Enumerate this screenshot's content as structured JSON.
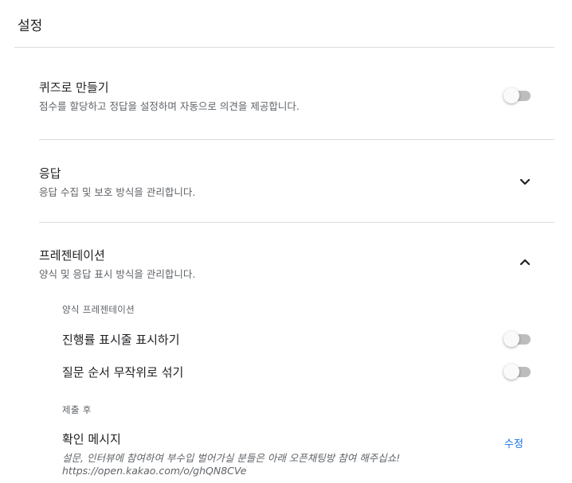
{
  "page": {
    "title": "설정"
  },
  "quiz": {
    "title": "퀴즈로 만들기",
    "description": "점수를 할당하고 정답을 설정하며 자동으로 의견을 제공합니다.",
    "enabled": false
  },
  "responses": {
    "title": "응답",
    "description": "응답 수집 및 보호 방식을 관리합니다.",
    "expanded": false,
    "icon": "chevron-down-icon"
  },
  "presentation": {
    "title": "프레젠테이션",
    "description": "양식 및 응답 표시 방식을 관리합니다.",
    "expanded": true,
    "icon": "chevron-up-icon",
    "form_presentation": {
      "heading": "양식 프레젠테이션",
      "show_progress_bar": {
        "label": "진행률 표시줄 표시하기",
        "enabled": false
      },
      "shuffle_questions": {
        "label": "질문 순서 무작위로 섞기",
        "enabled": false
      }
    },
    "after_submission": {
      "heading": "제출 후",
      "confirmation": {
        "label": "확인 메시지",
        "message": "설문, 인터뷰에 참여하여 부수입 벌어가실 분들은 아래 오픈채팅방 참여 해주십쇼!",
        "url": "https://open.kakao.com/o/ghQN8CVe",
        "edit_label": "수정"
      }
    }
  },
  "colors": {
    "accent": "#1a73e8",
    "divider": "#dadce0",
    "toggle_track_off": "#bdbdbd",
    "toggle_thumb_off": "#fafafa"
  }
}
